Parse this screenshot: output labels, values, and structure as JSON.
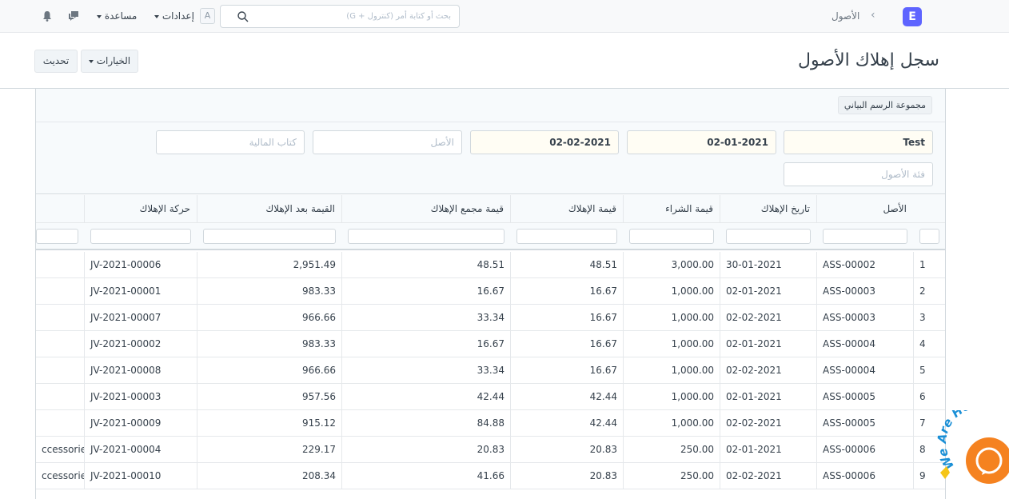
{
  "navbar": {
    "brand_letter": "E",
    "breadcrumb": "الأصول",
    "search_placeholder": "بحث أو كتابة أمر (كنترول + G)",
    "avatar_letter": "A",
    "settings_label": "إعدادات",
    "help_label": "مساعدة"
  },
  "page": {
    "title": "سجل إهلاك الأصول",
    "options_label": "الخيارات",
    "refresh_label": "تحديث"
  },
  "chart": {
    "group_label": "مجموعة الرسم البياني"
  },
  "filters": {
    "company": "Test",
    "from_date": "02-01-2021",
    "to_date": "02-02-2021",
    "asset_placeholder": "الأصل",
    "finance_book_placeholder": "كتاب المالية",
    "asset_category_placeholder": "فئة الأصول"
  },
  "table": {
    "columns": [
      "الأصل",
      "تاريخ الإهلاك",
      "قيمة الشراء",
      "قيمة الإهلاك",
      "قيمة مجمع الإهلاك",
      "القيمة بعد الإهلاك",
      "حركة الإهلاك"
    ],
    "rows": [
      {
        "idx": "1",
        "asset": "ASS-00002",
        "date": "30-01-2021",
        "purchase": "3,000.00",
        "dep": "48.51",
        "acc_dep": "48.51",
        "after": "2,951.49",
        "jv": "JV-2021-00006",
        "cat": ""
      },
      {
        "idx": "2",
        "asset": "ASS-00003",
        "date": "02-01-2021",
        "purchase": "1,000.00",
        "dep": "16.67",
        "acc_dep": "16.67",
        "after": "983.33",
        "jv": "JV-2021-00001",
        "cat": ""
      },
      {
        "idx": "3",
        "asset": "ASS-00003",
        "date": "02-02-2021",
        "purchase": "1,000.00",
        "dep": "16.67",
        "acc_dep": "33.34",
        "after": "966.66",
        "jv": "JV-2021-00007",
        "cat": ""
      },
      {
        "idx": "4",
        "asset": "ASS-00004",
        "date": "02-01-2021",
        "purchase": "1,000.00",
        "dep": "16.67",
        "acc_dep": "16.67",
        "after": "983.33",
        "jv": "JV-2021-00002",
        "cat": ""
      },
      {
        "idx": "5",
        "asset": "ASS-00004",
        "date": "02-02-2021",
        "purchase": "1,000.00",
        "dep": "16.67",
        "acc_dep": "33.34",
        "after": "966.66",
        "jv": "JV-2021-00008",
        "cat": ""
      },
      {
        "idx": "6",
        "asset": "ASS-00005",
        "date": "02-01-2021",
        "purchase": "1,000.00",
        "dep": "42.44",
        "acc_dep": "42.44",
        "after": "957.56",
        "jv": "JV-2021-00003",
        "cat": ""
      },
      {
        "idx": "7",
        "asset": "ASS-00005",
        "date": "02-02-2021",
        "purchase": "1,000.00",
        "dep": "42.44",
        "acc_dep": "84.88",
        "after": "915.12",
        "jv": "JV-2021-00009",
        "cat": ""
      },
      {
        "idx": "8",
        "asset": "ASS-00006",
        "date": "02-01-2021",
        "purchase": "250.00",
        "dep": "20.83",
        "acc_dep": "20.83",
        "after": "229.17",
        "jv": "JV-2021-00004",
        "cat": "ccessories"
      },
      {
        "idx": "9",
        "asset": "ASS-00006",
        "date": "02-02-2021",
        "purchase": "250.00",
        "dep": "20.83",
        "acc_dep": "41.66",
        "after": "208.34",
        "jv": "JV-2021-00010",
        "cat": "ccessories"
      }
    ]
  },
  "chat_widget": {
    "label": "We Are Here"
  }
}
